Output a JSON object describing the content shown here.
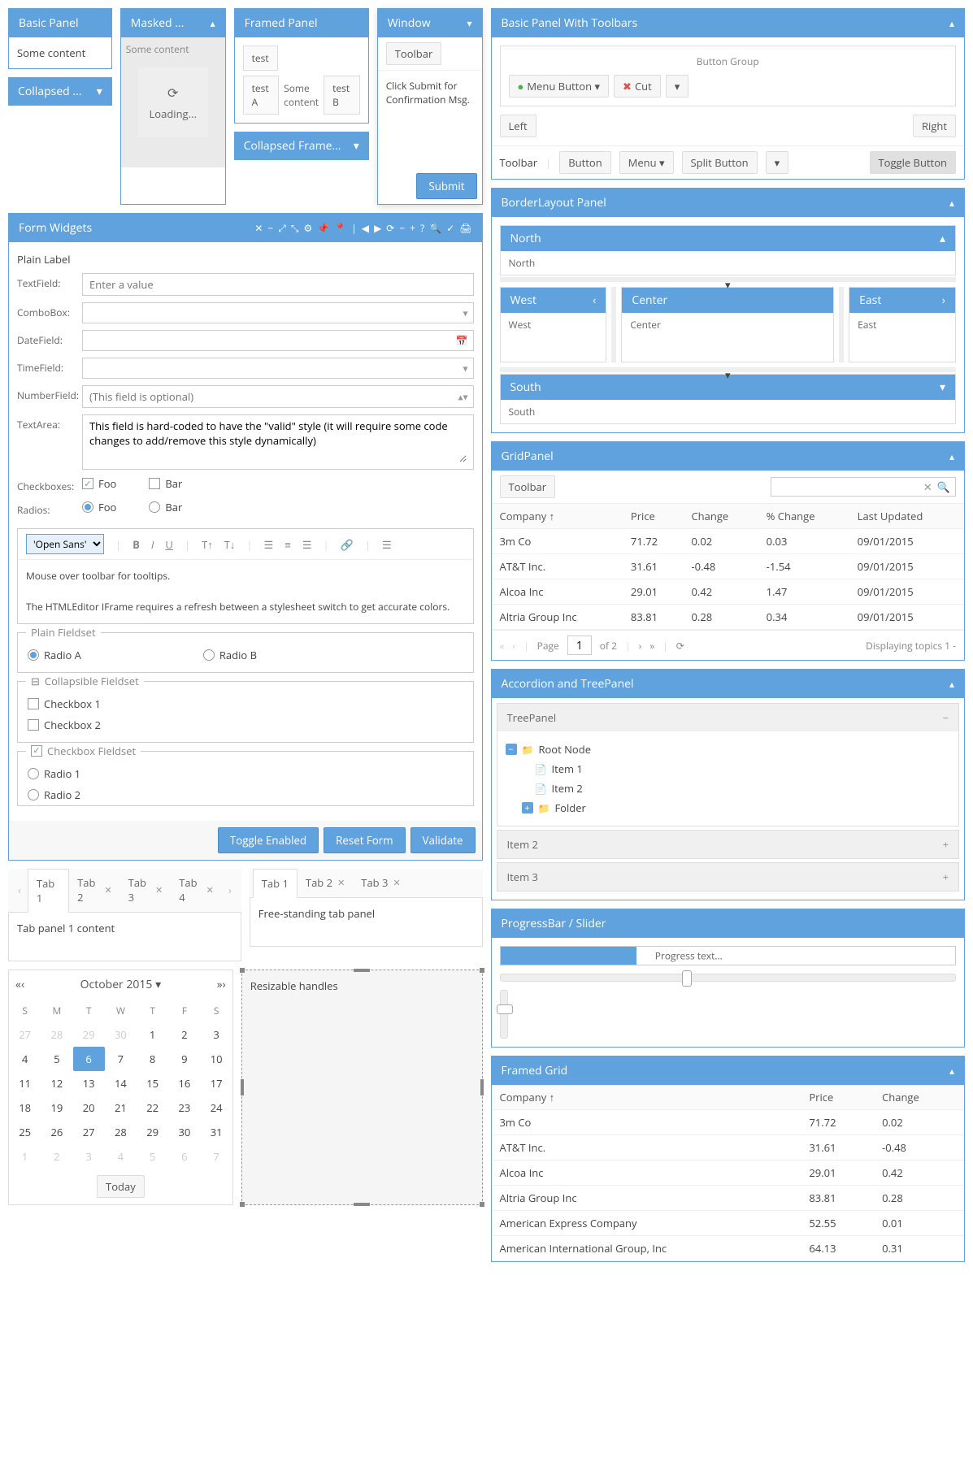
{
  "basic_panel": {
    "title": "Basic Panel",
    "content": "Some content"
  },
  "collapsed_panel": {
    "title": "Collapsed ..."
  },
  "masked_panel": {
    "title": "Masked ...",
    "content": "Some content",
    "loading": "Loading..."
  },
  "framed_panel": {
    "title": "Framed Panel",
    "items": [
      "test",
      "test A",
      "Some content",
      "test B"
    ]
  },
  "collapsed_framed": {
    "title": "Collapsed Frame..."
  },
  "window": {
    "title": "Window",
    "toolbar_btn": "Toolbar",
    "body": "Click Submit for Confirmation Msg.",
    "submit": "Submit"
  },
  "toolbars_panel": {
    "title": "Basic Panel With Toolbars",
    "group_title": "Button Group",
    "menu_btn": "Menu Button",
    "cut_btn": "Cut",
    "left": "Left",
    "right": "Right",
    "toolbar": "Toolbar",
    "button": "Button",
    "menu": "Menu",
    "split": "Split Button",
    "toggle": "Toggle Button"
  },
  "form": {
    "title": "Form Widgets",
    "plain_label": "Plain Label",
    "textfield": "TextField:",
    "textfield_ph": "Enter a value",
    "combobox": "ComboBox:",
    "datefield": "DateField:",
    "timefield": "TimeField:",
    "numberfield": "NumberField:",
    "number_ph": "(This field is optional)",
    "textarea": "TextArea:",
    "textarea_val": "This field is hard-coded to have the \"valid\" style (it will require some code changes to add/remove this style dynamically)",
    "checkboxes": "Checkboxes:",
    "foo": "Foo",
    "bar": "Bar",
    "radios": "Radios:",
    "font": "'Open Sans'",
    "he_line1": "Mouse over toolbar for tooltips.",
    "he_line2": "The HTMLEditor IFrame requires a refresh between a stylesheet switch to get accurate colors.",
    "plain_fieldset": "Plain Fieldset",
    "radio_a": "Radio A",
    "radio_b": "Radio B",
    "collapsible_fieldset": "Collapsible Fieldset",
    "checkbox1": "Checkbox 1",
    "checkbox2": "Checkbox 2",
    "checkbox_fieldset": "Checkbox Fieldset",
    "radio1": "Radio 1",
    "radio2": "Radio 2",
    "toggle_enabled": "Toggle Enabled",
    "reset_form": "Reset Form",
    "validate": "Validate"
  },
  "tabpanel": {
    "tabs": [
      "Tab 1",
      "Tab 2",
      "Tab 3",
      "Tab 4"
    ],
    "content": "Tab panel 1 content"
  },
  "free_tabs": {
    "tabs": [
      "Tab 1",
      "Tab 2",
      "Tab 3"
    ],
    "content": "Free-standing tab panel"
  },
  "calendar": {
    "month": "October 2015",
    "days": [
      "S",
      "M",
      "T",
      "W",
      "T",
      "F",
      "S"
    ],
    "prev_days": [
      27,
      28,
      29,
      30
    ],
    "this_days": [
      1,
      2,
      3,
      4,
      5,
      6,
      7,
      8,
      9,
      10,
      11,
      12,
      13,
      14,
      15,
      16,
      17,
      18,
      19,
      20,
      21,
      22,
      23,
      24,
      25,
      26,
      27,
      28,
      29,
      30,
      31
    ],
    "next_days": [
      1,
      2,
      3,
      4,
      5,
      6,
      7
    ],
    "today_val": 6,
    "today_btn": "Today"
  },
  "resizable": {
    "text": "Resizable handles"
  },
  "borderlayout": {
    "title": "BorderLayout Panel",
    "north": "North",
    "west": "West",
    "center": "Center",
    "east": "East",
    "south": "South"
  },
  "grid": {
    "title": "GridPanel",
    "toolbar": "Toolbar",
    "cols": [
      "Company",
      "Price",
      "Change",
      "% Change",
      "Last Updated"
    ],
    "rows": [
      [
        "3m Co",
        "71.72",
        "0.02",
        "0.03",
        "09/01/2015"
      ],
      [
        "AT&T Inc.",
        "31.61",
        "-0.48",
        "-1.54",
        "09/01/2015"
      ],
      [
        "Alcoa Inc",
        "29.01",
        "0.42",
        "1.47",
        "09/01/2015"
      ],
      [
        "Altria Group Inc",
        "83.81",
        "0.28",
        "0.34",
        "09/01/2015"
      ]
    ],
    "paging": {
      "page_label": "Page",
      "page": "1",
      "of": "of 2",
      "display": "Displaying topics 1 -"
    }
  },
  "accordion": {
    "title": "Accordion and TreePanel",
    "tree_title": "TreePanel",
    "root": "Root Node",
    "item1": "Item 1",
    "item2": "Item 2",
    "folder": "Folder",
    "acc_item2": "Item 2",
    "acc_item3": "Item 3"
  },
  "progress": {
    "title": "ProgressBar / Slider",
    "text": "Progress text..."
  },
  "framed_grid": {
    "title": "Framed Grid",
    "cols": [
      "Company",
      "Price",
      "Change"
    ],
    "rows": [
      [
        "3m Co",
        "71.72",
        "0.02"
      ],
      [
        "AT&T Inc.",
        "31.61",
        "-0.48"
      ],
      [
        "Alcoa Inc",
        "29.01",
        "0.42"
      ],
      [
        "Altria Group Inc",
        "83.81",
        "0.28"
      ],
      [
        "American Express Company",
        "52.55",
        "0.01"
      ],
      [
        "American International Group, Inc",
        "64.13",
        "0.31"
      ]
    ]
  }
}
